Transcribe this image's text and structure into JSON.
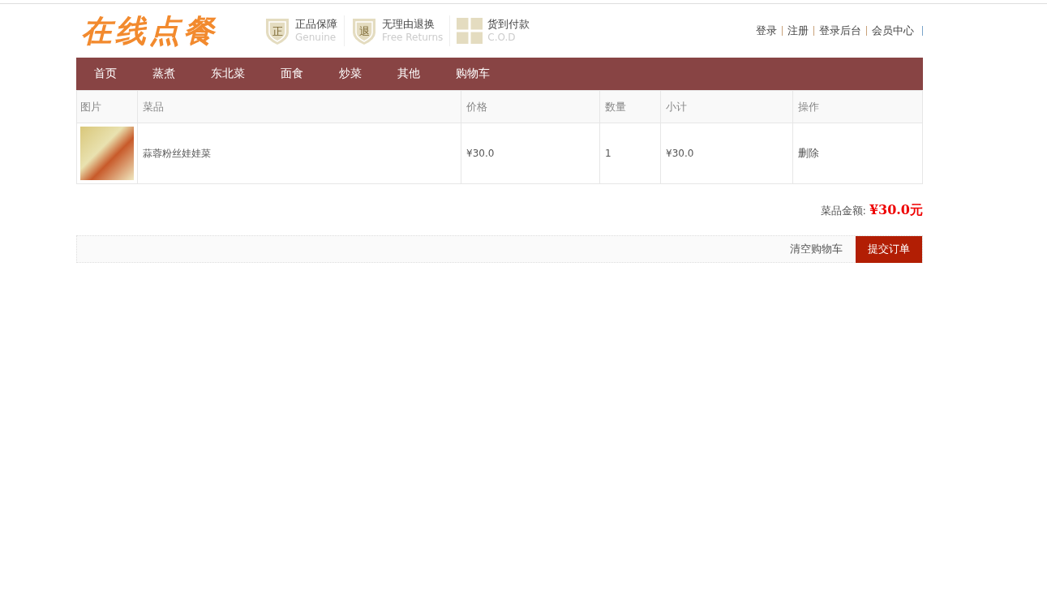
{
  "logo": "在线点餐",
  "badges": [
    {
      "kind": "shield",
      "mark": "正",
      "title": "正品保障",
      "subtitle": "Genuine"
    },
    {
      "kind": "shield",
      "mark": "退",
      "title": "无理由退换",
      "subtitle": "Free Returns"
    },
    {
      "kind": "gift",
      "title": "货到付款",
      "subtitle": "C.O.D"
    }
  ],
  "top_links": [
    "登录",
    "注册",
    "登录后台",
    "会员中心"
  ],
  "nav": [
    "首页",
    "蒸煮",
    "东北菜",
    "面食",
    "炒菜",
    "其他",
    "购物车"
  ],
  "table": {
    "columns": [
      "图片",
      "菜品",
      "价格",
      "数量",
      "小计",
      "操作"
    ],
    "rows": [
      {
        "dish": "蒜蓉粉丝娃娃菜",
        "price": "¥30.0",
        "quantity": "1",
        "subtotal": "¥30.0",
        "action": "删除"
      }
    ]
  },
  "total": {
    "label": "菜品金额:",
    "amount": "¥30.0元"
  },
  "actions": {
    "clear": "清空购物车",
    "submit": "提交订单"
  }
}
